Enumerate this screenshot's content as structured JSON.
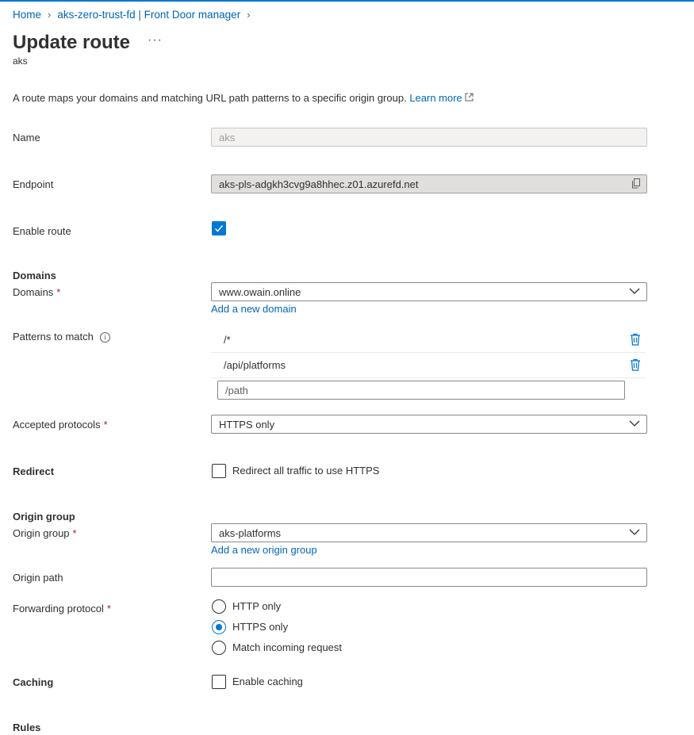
{
  "breadcrumb": {
    "items": [
      "Home",
      "aks-zero-trust-fd | Front Door manager"
    ]
  },
  "header": {
    "title": "Update route",
    "more": "···",
    "subtitle": "aks"
  },
  "description": {
    "text": "A route maps your domains and matching URL path patterns to a specific origin group.",
    "link": "Learn more"
  },
  "form": {
    "name": {
      "label": "Name",
      "value": "aks"
    },
    "endpoint": {
      "label": "Endpoint",
      "value": "aks-pls-adgkh3cvg9a8hhec.z01.azurefd.net"
    },
    "enable_route": {
      "label": "Enable route",
      "checked": true
    },
    "domains_section": "Domains",
    "domains": {
      "label": "Domains",
      "required": "*",
      "value": "www.owain.online",
      "add_link": "Add a new domain"
    },
    "patterns": {
      "label": "Patterns to match",
      "info": "i",
      "items": [
        "/*",
        "/api/platforms"
      ],
      "placeholder": "/path"
    },
    "protocols": {
      "label": "Accepted protocols",
      "required": "*",
      "value": "HTTPS only"
    },
    "redirect": {
      "section": "Redirect",
      "label": "Redirect all traffic to use HTTPS",
      "checked": false
    },
    "origin_section": "Origin group",
    "origin_group": {
      "label": "Origin group",
      "required": "*",
      "value": "aks-platforms",
      "add_link": "Add a new origin group"
    },
    "origin_path": {
      "label": "Origin path",
      "value": ""
    },
    "forwarding": {
      "label": "Forwarding protocol",
      "required": "*",
      "options": [
        "HTTP only",
        "HTTPS only",
        "Match incoming request"
      ],
      "selected": "HTTPS only"
    },
    "caching": {
      "section": "Caching",
      "label": "Enable caching",
      "checked": false
    },
    "rules_section": "Rules"
  },
  "colors": {
    "accent": "#0078d4",
    "link": "#0066b8",
    "required": "#a4262c"
  }
}
